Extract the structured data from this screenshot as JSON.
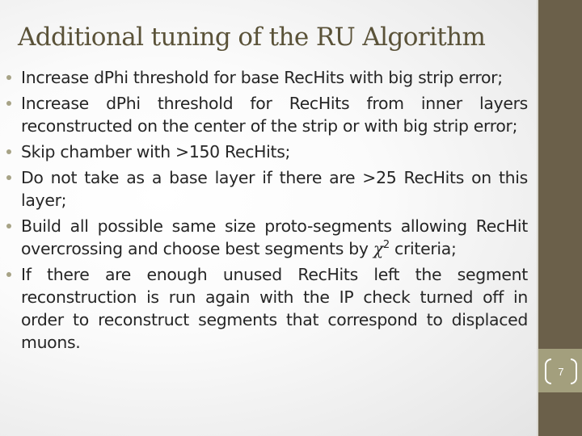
{
  "slide": {
    "title": "Additional tuning of the RU Algorithm",
    "page_number": "7",
    "colors": {
      "title": "#5a5238",
      "side_bar": "#6b604a",
      "page_band": "#a39f7d",
      "bullet": "#a7a386",
      "body_text": "#262626"
    }
  },
  "bullets": [
    {
      "text": "Increase dPhi threshold for base RecHits with big strip error;"
    },
    {
      "text": "Increase dPhi threshold for RecHits from inner layers reconstructed on the center of the strip or with big strip error;"
    },
    {
      "text": "Skip chamber with >150 RecHits;"
    },
    {
      "text": "Do not take as a base layer if there are >25 RecHits on this layer;"
    },
    {
      "text_before": "Build all possible same size proto-segments allowing RecHit overcrossing and choose best segments by ",
      "symbol": "χ",
      "superscript": "2",
      "text_after": " criteria;"
    },
    {
      "text": "If there are enough unused RecHits left the segment reconstruction is run again with the IP check turned off in order to reconstruct segments that correspond to displaced muons."
    }
  ]
}
